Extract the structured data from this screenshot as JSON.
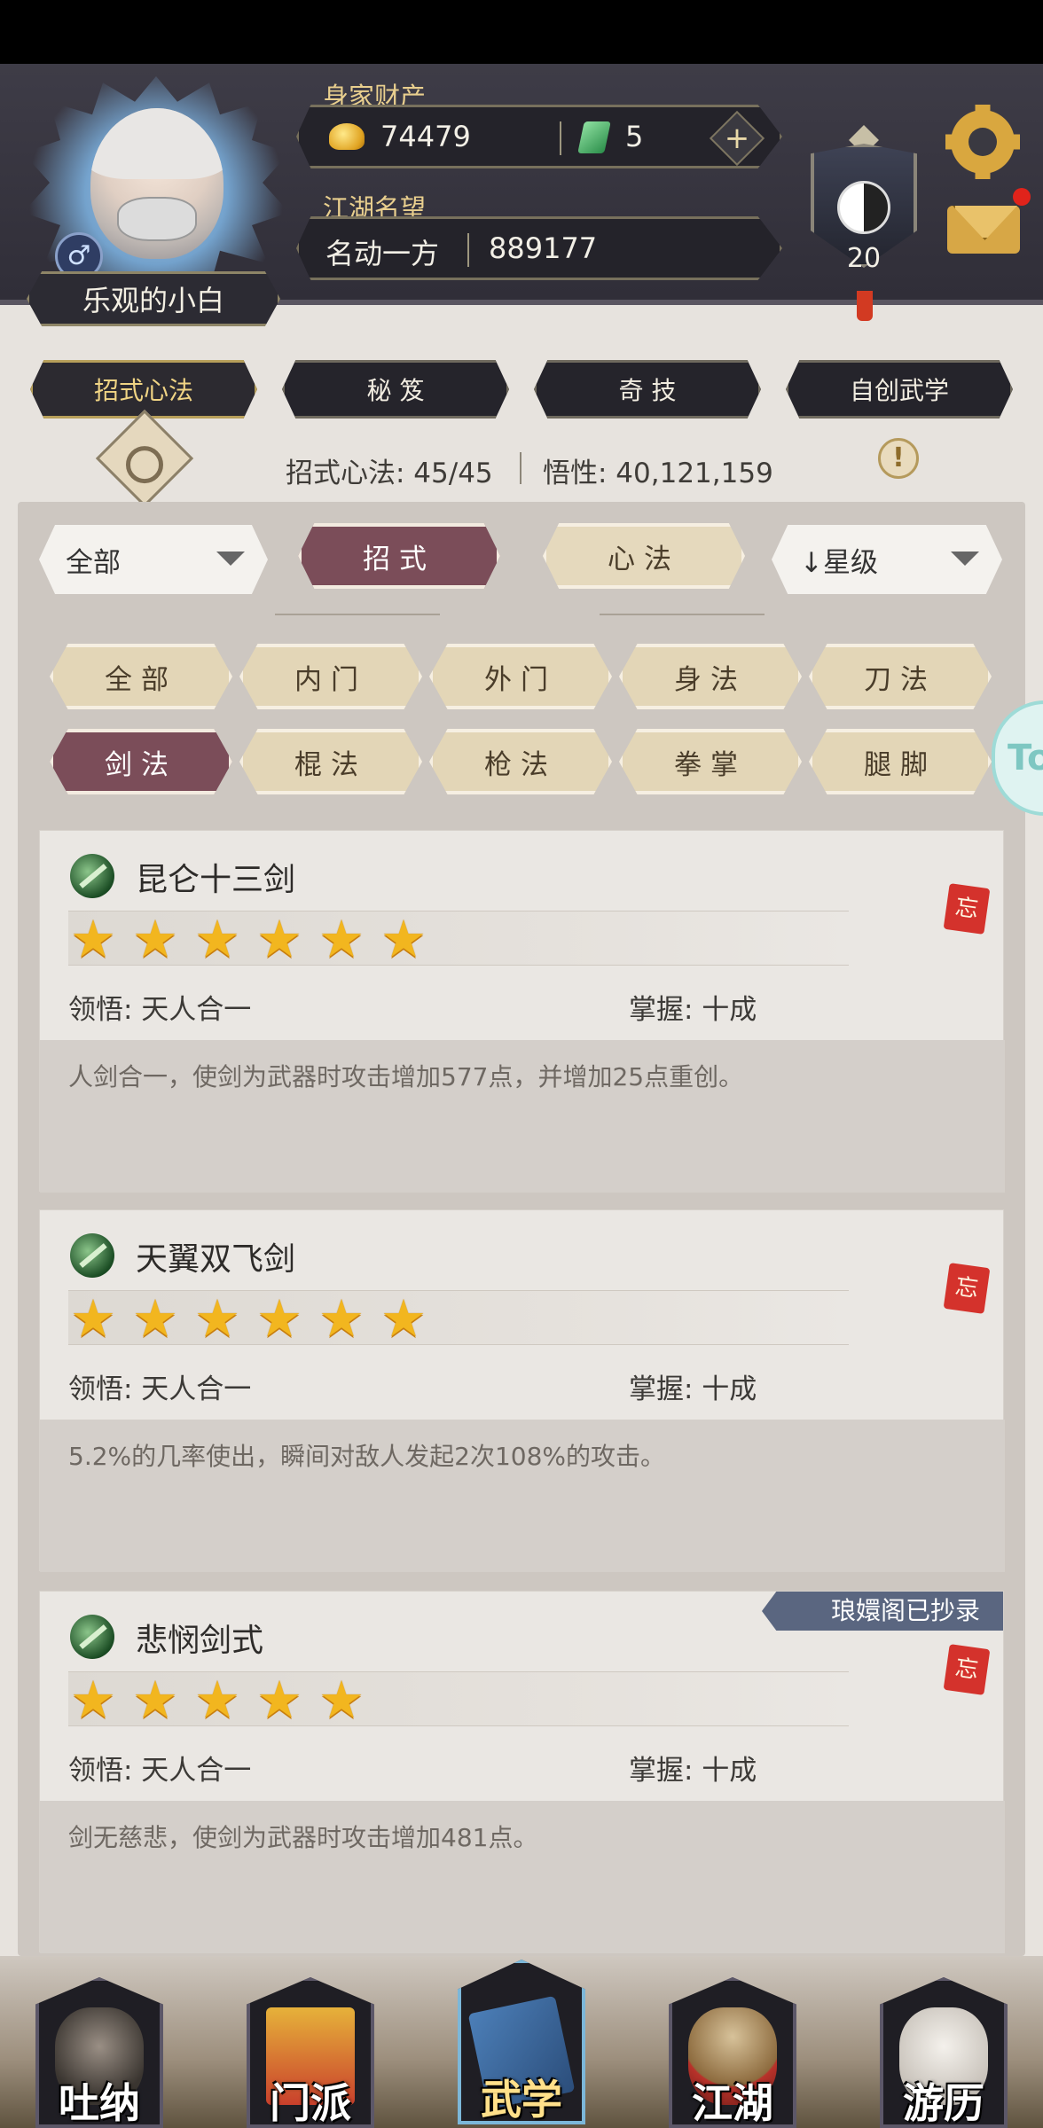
{
  "header": {
    "player_name": "乐观的小白",
    "gender_symbol": "♂",
    "wealth_label": "身家财产",
    "gold_amount": "74479",
    "jade_amount": "5",
    "plus_symbol": "+",
    "reputation_label": "江湖名望",
    "reputation_title": "名动一方",
    "reputation_value": "889177",
    "level": "20"
  },
  "main_tabs": [
    {
      "label": "招式心法",
      "active": true
    },
    {
      "label": "秘 笈",
      "active": false
    },
    {
      "label": "奇 技",
      "active": false
    },
    {
      "label": "自创武学",
      "active": false
    }
  ],
  "stats": {
    "moves_text": "招式心法: 45/45",
    "insight_text": "悟性: 40,121,159",
    "info_symbol": "!"
  },
  "filters": {
    "scope_select": "全部",
    "type_tabs": [
      {
        "label": "招式",
        "active": true
      },
      {
        "label": "心法",
        "active": false
      }
    ],
    "sort_select": "↓星级"
  },
  "categories": [
    {
      "label": "全部",
      "active": false
    },
    {
      "label": "内门",
      "active": false
    },
    {
      "label": "外门",
      "active": false
    },
    {
      "label": "身法",
      "active": false
    },
    {
      "label": "刀法",
      "active": false
    },
    {
      "label": "剑法",
      "active": true
    },
    {
      "label": "棍法",
      "active": false
    },
    {
      "label": "枪法",
      "active": false
    },
    {
      "label": "拳掌",
      "active": false
    },
    {
      "label": "腿脚",
      "active": false
    }
  ],
  "side_tab_text": "To",
  "skills": [
    {
      "name": "昆仑十三剑",
      "stars": 6,
      "comprehension": "领悟: 天人合一",
      "mastery": "掌握: 十成",
      "description": "人剑合一，使剑为武器时攻击增加577点，并增加25点重创。",
      "seal": "忘",
      "ribbon": ""
    },
    {
      "name": "天翼双飞剑",
      "stars": 6,
      "comprehension": "领悟: 天人合一",
      "mastery": "掌握: 十成",
      "description": "5.2%的几率使出，瞬间对敌人发起2次108%的攻击。",
      "seal": "忘",
      "ribbon": ""
    },
    {
      "name": "悲悯剑式",
      "stars": 5,
      "comprehension": "领悟: 天人合一",
      "mastery": "掌握: 十成",
      "description": "剑无慈悲，使剑为武器时攻击增加481点。",
      "seal": "忘",
      "ribbon": "琅嬛阁已抄录"
    }
  ],
  "bottom_nav": [
    {
      "label": "吐纳",
      "active": false
    },
    {
      "label": "门派",
      "active": false
    },
    {
      "label": "武学",
      "active": true
    },
    {
      "label": "江湖",
      "active": false
    },
    {
      "label": "游历",
      "active": false
    }
  ],
  "colors": {
    "accent_gold": "#e9cf8e",
    "active_tab": "#7b4d59",
    "inactive_tab": "#e3d6b7",
    "star": "#f2b61f",
    "ribbon": "#5a6680"
  }
}
